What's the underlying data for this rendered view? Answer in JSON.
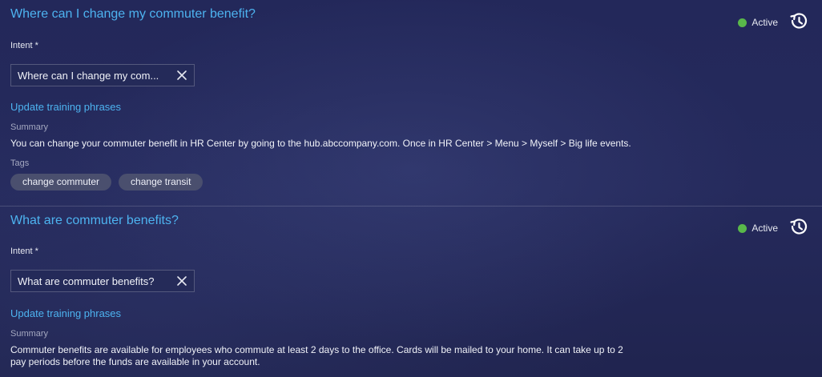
{
  "items": [
    {
      "title": "Where can I change my commuter benefit?",
      "status": "Active",
      "status_color": "#59b84a",
      "intent_label": "Intent *",
      "intent_value": "Where can I change my com...",
      "update_link": "Update training phrases",
      "summary_label": "Summary",
      "summary": "You can change your commuter benefit in HR Center by going to the hub.abccompany.com. Once in HR Center > Menu > Myself > Big life events.",
      "tags_label": "Tags",
      "tags": [
        "change commuter",
        "change transit"
      ]
    },
    {
      "title": "What are commuter benefits?",
      "status": "Active",
      "status_color": "#59b84a",
      "intent_label": "Intent *",
      "intent_value": "What are commuter benefits?",
      "update_link": "Update training phrases",
      "summary_label": "Summary",
      "summary": "Commuter benefits are available for employees who commute at least 2 days to the office. Cards will be mailed to your home. It can take up to 2 pay periods before the funds are available in your account."
    }
  ],
  "icons": {
    "history": "history-icon",
    "clear": "close-icon"
  },
  "colors": {
    "accent": "#4db3f0",
    "active": "#59b84a",
    "tag_bg": "#4a4f6e"
  }
}
